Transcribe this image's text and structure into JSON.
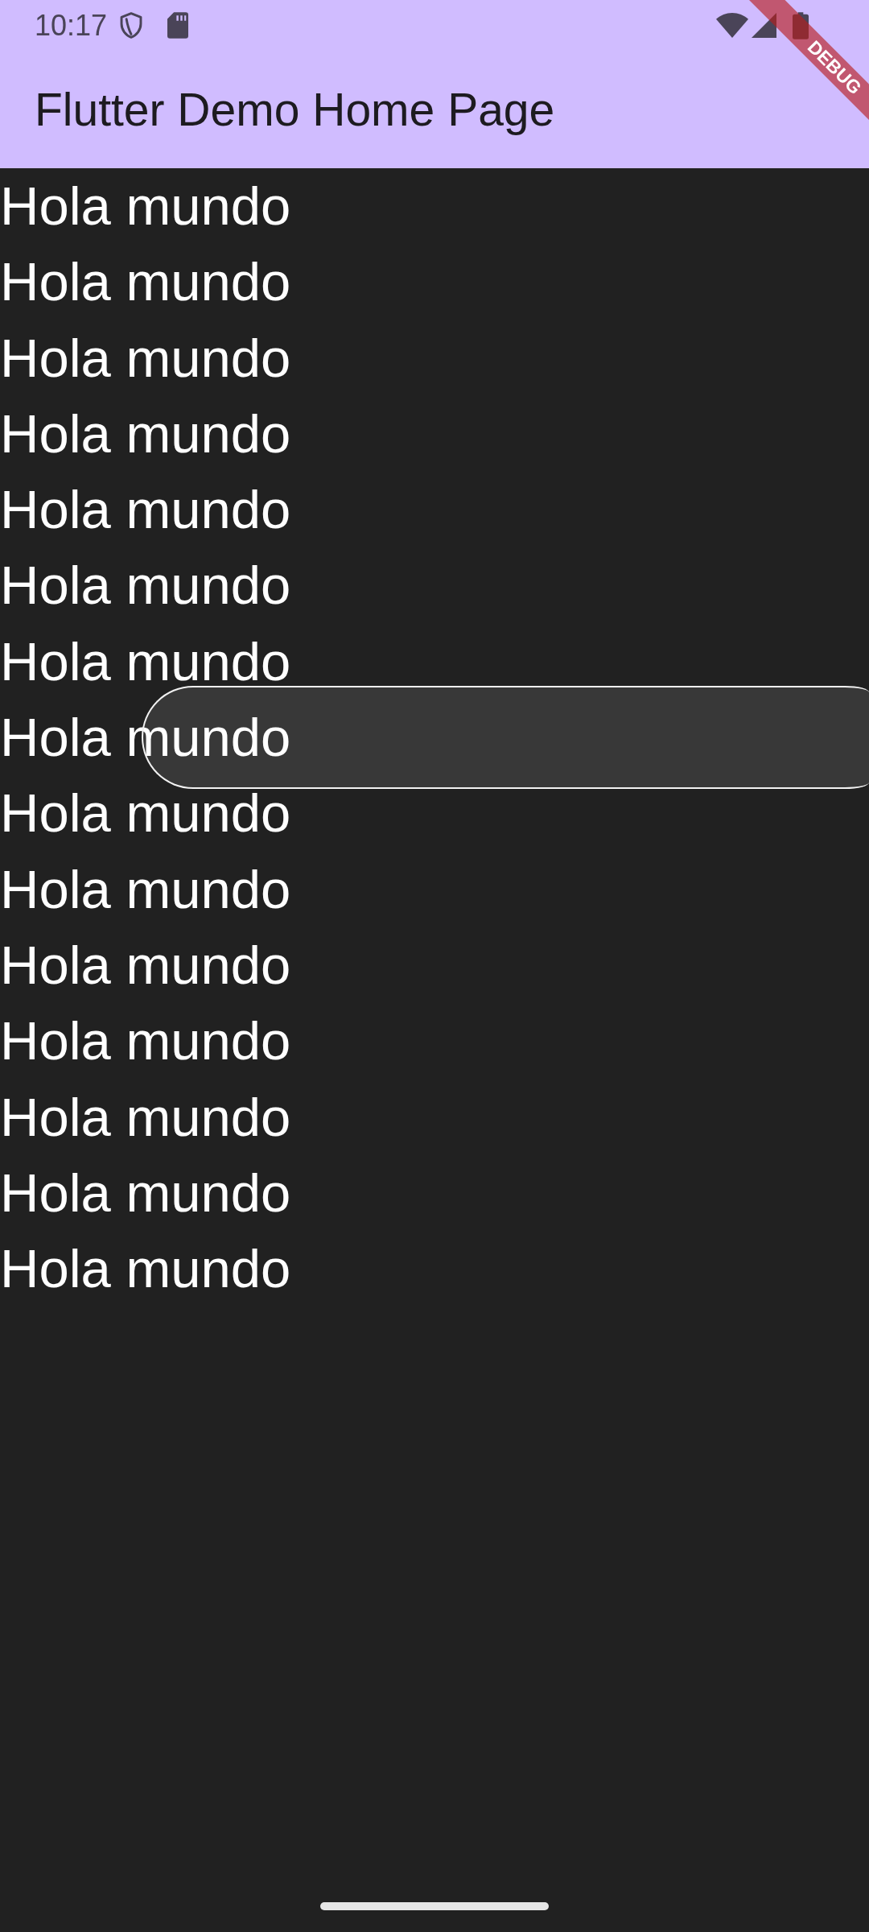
{
  "status_bar": {
    "time": "10:17"
  },
  "app_bar": {
    "title": "Flutter Demo Home Page"
  },
  "debug_banner": {
    "label": "DEBUG"
  },
  "list": {
    "items": [
      "Hola mundo",
      "Hola mundo",
      "Hola mundo",
      "Hola mundo",
      "Hola mundo",
      "Hola mundo",
      "Hola mundo",
      "Hola mundo",
      "Hola mundo",
      "Hola mundo",
      "Hola mundo",
      "Hola mundo",
      "Hola mundo",
      "Hola mundo",
      "Hola mundo"
    ]
  }
}
